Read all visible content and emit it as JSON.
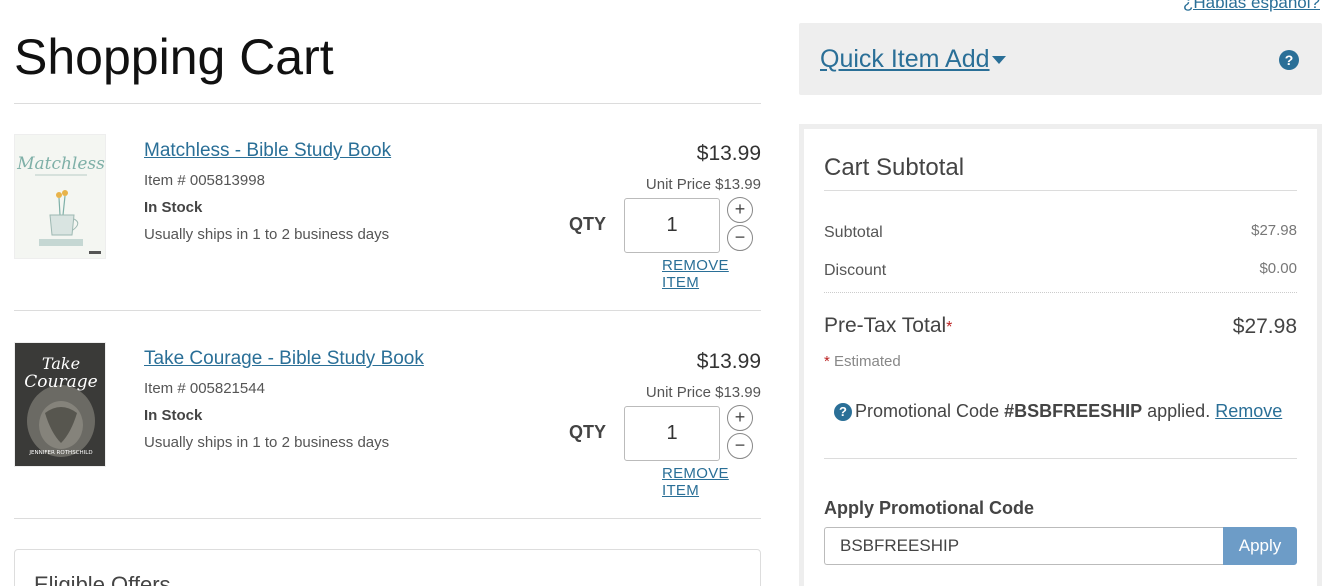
{
  "header": {
    "lang_link": "¿Hablas español?",
    "page_title": "Shopping Cart"
  },
  "cart": {
    "items": [
      {
        "name": "Matchless - Bible Study Book",
        "item_number": "Item # 005813998",
        "stock": "In Stock",
        "shipping": "Usually ships in 1 to 2 business days",
        "price": "$13.99",
        "unit_price": "Unit Price $13.99",
        "qty_label": "QTY",
        "qty": "1",
        "plus": "+",
        "minus": "−",
        "remove": "REMOVE ITEM"
      },
      {
        "name": "Take Courage - Bible Study Book",
        "item_number": "Item # 005821544",
        "stock": "In Stock",
        "shipping": "Usually ships in 1 to 2 business days",
        "price": "$13.99",
        "unit_price": "Unit Price $13.99",
        "qty_label": "QTY",
        "qty": "1",
        "plus": "+",
        "minus": "−",
        "remove": "REMOVE ITEM"
      }
    ],
    "covers": [
      {
        "title": "Matchless",
        "color": "#f4f6f2",
        "accent": "#7fb0a8"
      },
      {
        "title_line1": "Take",
        "title_line2": "Courage",
        "author": "JENNIFER ROTHSCHILD",
        "color": "#3a3a38",
        "accent": "#ffffff"
      }
    ]
  },
  "offers": {
    "title": "Eligible Offers"
  },
  "quick_add": {
    "label": "Quick Item Add",
    "help_icon": "?"
  },
  "summary": {
    "title": "Cart Subtotal",
    "subtotal_label": "Subtotal",
    "subtotal_value": "$27.98",
    "discount_label": "Discount",
    "discount_value": "$0.00",
    "pretax_label": "Pre-Tax Total",
    "pretax_star": "*",
    "pretax_value": "$27.98",
    "estimated_star": "*",
    "estimated_text": " Estimated",
    "promo_help_icon": "?",
    "promo_prefix": "Promotional Code ",
    "promo_code": "#BSBFREESHIP",
    "promo_suffix": " applied. ",
    "promo_remove": "Remove",
    "apply_title": "Apply Promotional Code",
    "promo_input_value": "BSBFREESHIP",
    "apply_button": "Apply"
  },
  "colors": {
    "link": "#2a6f97",
    "apply_button": "#6d9cc7",
    "panel_bg": "#eeeeee"
  }
}
